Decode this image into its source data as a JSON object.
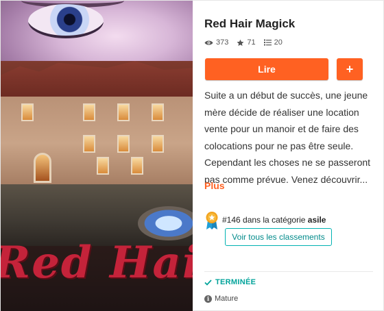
{
  "story": {
    "title": "Red Hair Magick",
    "cover_art_text": "Red Hair Magick"
  },
  "stats": {
    "reads": "373",
    "votes": "71",
    "parts": "20"
  },
  "actions": {
    "read_label": "Lire",
    "add_label": "+"
  },
  "description": {
    "text": "Suite a un début de succès, une jeune mère décide de réaliser une location vente pour un manoir et de faire des colocations pour ne pas être seule. Cependant les choses ne se passeront pas comme prévue. Venez découvrir...",
    "more_label": "Plus"
  },
  "ranking": {
    "rank": "#146",
    "middle": " dans la catégorie ",
    "category": "asile",
    "view_all_label": "Voir tous les classements"
  },
  "status": {
    "completed_label": "TERMINÉE",
    "mature_label": "Mature"
  },
  "colors": {
    "accent": "#ff6122",
    "teal": "#00a39a"
  },
  "icons": [
    "eye-icon",
    "star-icon",
    "list-icon",
    "medal-icon",
    "checkmark-icon",
    "info-icon"
  ]
}
